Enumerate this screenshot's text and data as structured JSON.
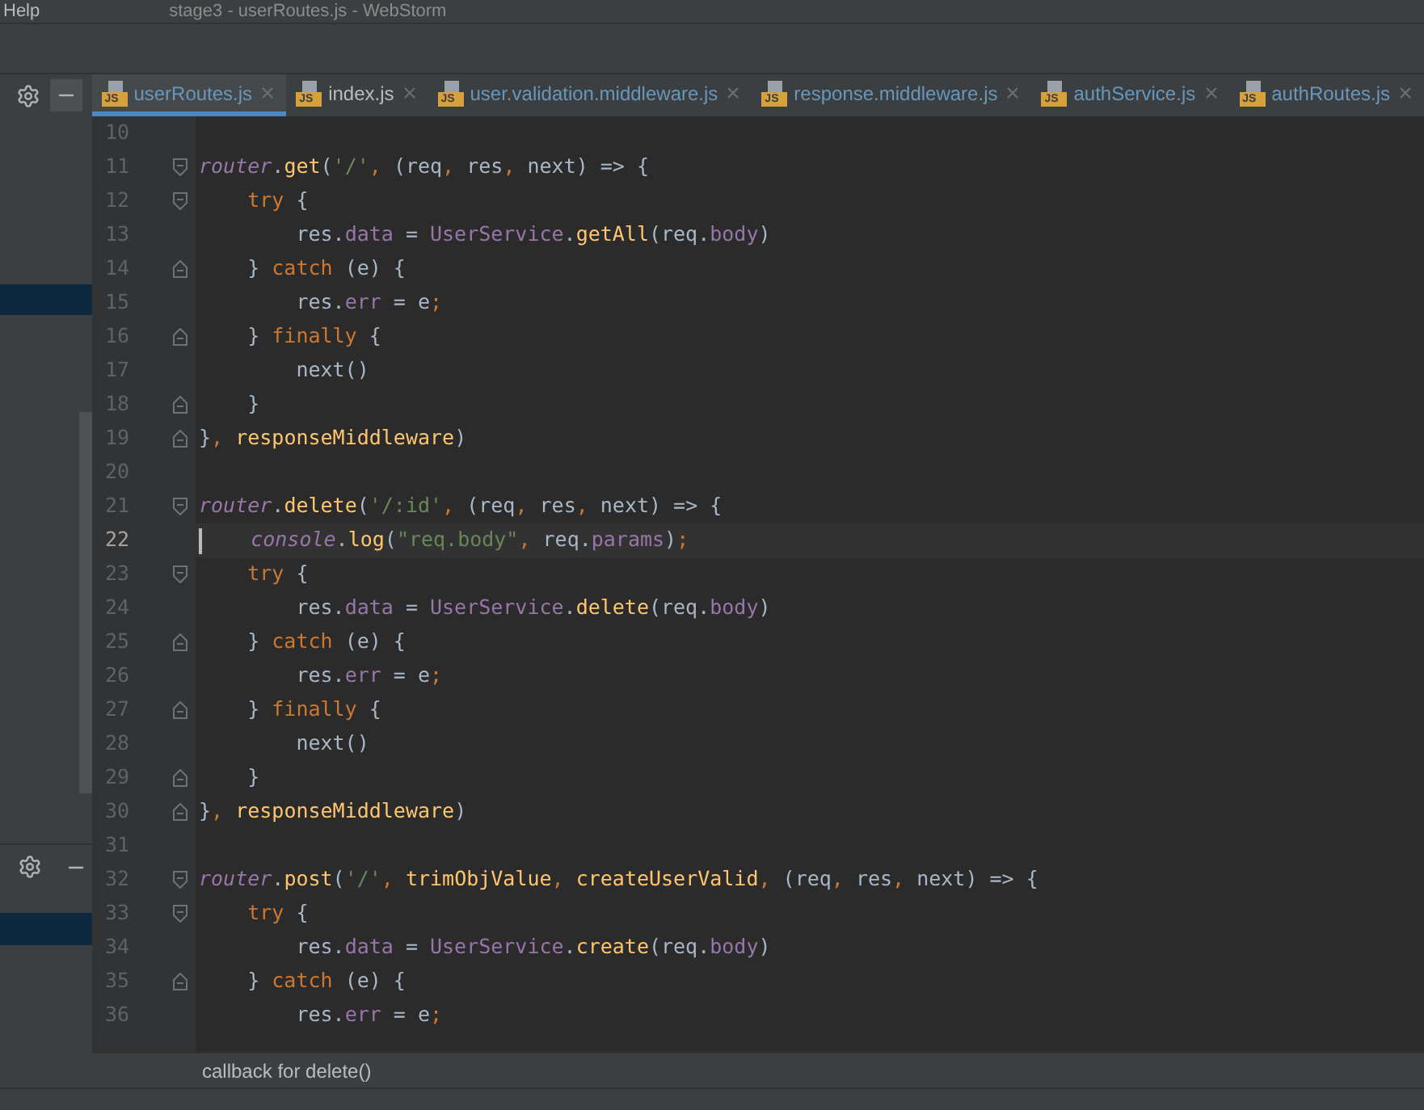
{
  "menu_bar": {
    "menu": "Help",
    "title": "stage3 - userRoutes.js - WebStorm"
  },
  "tabs": [
    {
      "label": "userRoutes.js",
      "badge": "JS",
      "selected": true
    },
    {
      "label": "index.js",
      "badge": "JS",
      "selected": false
    },
    {
      "label": "user.validation.middleware.js",
      "badge": "JS",
      "selected": false
    },
    {
      "label": "response.middleware.js",
      "badge": "JS",
      "selected": false
    },
    {
      "label": "authService.js",
      "badge": "JS",
      "selected": false
    },
    {
      "label": "authRoutes.js",
      "badge": "JS",
      "selected": false
    }
  ],
  "editor": {
    "lines": [
      {
        "number": "10",
        "current": false,
        "fold_start": false,
        "fold_end": false
      },
      {
        "number": "11",
        "current": false,
        "fold_start": true,
        "fold_end": false,
        "tokens": [
          {
            "kind": "obj",
            "text": "router"
          },
          {
            "kind": "plain",
            "text": "."
          },
          {
            "kind": "method",
            "text": "get"
          },
          {
            "kind": "plain",
            "text": "("
          },
          {
            "kind": "str",
            "text": "'/'"
          },
          {
            "kind": "punct",
            "text": ", "
          },
          {
            "kind": "plain",
            "text": "(req"
          },
          {
            "kind": "punct",
            "text": ", "
          },
          {
            "kind": "plain",
            "text": "res"
          },
          {
            "kind": "punct",
            "text": ", "
          },
          {
            "kind": "plain",
            "text": "next) => {"
          }
        ]
      },
      {
        "number": "12",
        "current": false,
        "fold_start": true,
        "fold_end": false,
        "tokens": [
          {
            "kind": "kw",
            "text": "    try"
          },
          {
            "kind": "plain",
            "text": " {"
          }
        ]
      },
      {
        "number": "13",
        "current": false,
        "fold_start": false,
        "fold_end": false,
        "tokens": [
          {
            "kind": "plain",
            "text": "        res."
          },
          {
            "kind": "prop",
            "text": "data"
          },
          {
            "kind": "plain",
            "text": " = "
          },
          {
            "kind": "prop",
            "text": "UserService"
          },
          {
            "kind": "plain",
            "text": "."
          },
          {
            "kind": "method",
            "text": "getAll"
          },
          {
            "kind": "plain",
            "text": "(req."
          },
          {
            "kind": "prop",
            "text": "body"
          },
          {
            "kind": "plain",
            "text": ")"
          }
        ]
      },
      {
        "number": "14",
        "current": false,
        "fold_start": false,
        "fold_end": true,
        "tokens": [
          {
            "kind": "plain",
            "text": "    } "
          },
          {
            "kind": "kw",
            "text": "catch"
          },
          {
            "kind": "plain",
            "text": " (e) {"
          }
        ]
      },
      {
        "number": "15",
        "current": false,
        "fold_start": false,
        "fold_end": false,
        "tokens": [
          {
            "kind": "plain",
            "text": "        res."
          },
          {
            "kind": "prop",
            "text": "err"
          },
          {
            "kind": "plain",
            "text": " = e"
          },
          {
            "kind": "punct",
            "text": ";"
          }
        ]
      },
      {
        "number": "16",
        "current": false,
        "fold_start": false,
        "fold_end": true,
        "tokens": [
          {
            "kind": "plain",
            "text": "    } "
          },
          {
            "kind": "kw",
            "text": "finally"
          },
          {
            "kind": "plain",
            "text": " {"
          }
        ]
      },
      {
        "number": "17",
        "current": false,
        "fold_start": false,
        "fold_end": false,
        "tokens": [
          {
            "kind": "plain",
            "text": "        next()"
          }
        ]
      },
      {
        "number": "18",
        "current": false,
        "fold_start": false,
        "fold_end": true,
        "tokens": [
          {
            "kind": "plain",
            "text": "    }"
          }
        ]
      },
      {
        "number": "19",
        "current": false,
        "fold_start": false,
        "fold_end": true,
        "tokens": [
          {
            "kind": "plain",
            "text": "}"
          },
          {
            "kind": "punct",
            "text": ", "
          },
          {
            "kind": "method",
            "text": "responseMiddleware"
          },
          {
            "kind": "plain",
            "text": ")"
          }
        ]
      },
      {
        "number": "20",
        "current": false,
        "fold_start": false,
        "fold_end": false
      },
      {
        "number": "21",
        "current": false,
        "fold_start": true,
        "fold_end": false,
        "tokens": [
          {
            "kind": "obj",
            "text": "router"
          },
          {
            "kind": "plain",
            "text": "."
          },
          {
            "kind": "method",
            "text": "delete"
          },
          {
            "kind": "plain",
            "text": "("
          },
          {
            "kind": "str",
            "text": "'/:id'"
          },
          {
            "kind": "punct",
            "text": ", "
          },
          {
            "kind": "plain",
            "text": "(req"
          },
          {
            "kind": "punct",
            "text": ", "
          },
          {
            "kind": "plain",
            "text": "res"
          },
          {
            "kind": "punct",
            "text": ", "
          },
          {
            "kind": "plain",
            "text": "next) => {"
          }
        ]
      },
      {
        "number": "22",
        "current": true,
        "fold_start": false,
        "fold_end": false,
        "tokens": [
          {
            "kind": "obj",
            "text": "    console"
          },
          {
            "kind": "plain",
            "text": "."
          },
          {
            "kind": "method",
            "text": "log"
          },
          {
            "kind": "plain",
            "text": "("
          },
          {
            "kind": "str",
            "text": "\"req.body\""
          },
          {
            "kind": "punct",
            "text": ", "
          },
          {
            "kind": "plain",
            "text": "req."
          },
          {
            "kind": "prop",
            "text": "params"
          },
          {
            "kind": "plain",
            "text": ")"
          },
          {
            "kind": "punct",
            "text": ";"
          }
        ]
      },
      {
        "number": "23",
        "current": false,
        "fold_start": true,
        "fold_end": false,
        "tokens": [
          {
            "kind": "kw",
            "text": "    try"
          },
          {
            "kind": "plain",
            "text": " {"
          }
        ]
      },
      {
        "number": "24",
        "current": false,
        "fold_start": false,
        "fold_end": false,
        "tokens": [
          {
            "kind": "plain",
            "text": "        res."
          },
          {
            "kind": "prop",
            "text": "data"
          },
          {
            "kind": "plain",
            "text": " = "
          },
          {
            "kind": "prop",
            "text": "UserService"
          },
          {
            "kind": "plain",
            "text": "."
          },
          {
            "kind": "method",
            "text": "delete"
          },
          {
            "kind": "plain",
            "text": "(req."
          },
          {
            "kind": "prop",
            "text": "body"
          },
          {
            "kind": "plain",
            "text": ")"
          }
        ]
      },
      {
        "number": "25",
        "current": false,
        "fold_start": false,
        "fold_end": true,
        "tokens": [
          {
            "kind": "plain",
            "text": "    } "
          },
          {
            "kind": "kw",
            "text": "catch"
          },
          {
            "kind": "plain",
            "text": " (e) {"
          }
        ]
      },
      {
        "number": "26",
        "current": false,
        "fold_start": false,
        "fold_end": false,
        "tokens": [
          {
            "kind": "plain",
            "text": "        res."
          },
          {
            "kind": "prop",
            "text": "err"
          },
          {
            "kind": "plain",
            "text": " = e"
          },
          {
            "kind": "punct",
            "text": ";"
          }
        ]
      },
      {
        "number": "27",
        "current": false,
        "fold_start": false,
        "fold_end": true,
        "tokens": [
          {
            "kind": "plain",
            "text": "    } "
          },
          {
            "kind": "kw",
            "text": "finally"
          },
          {
            "kind": "plain",
            "text": " {"
          }
        ]
      },
      {
        "number": "28",
        "current": false,
        "fold_start": false,
        "fold_end": false,
        "tokens": [
          {
            "kind": "plain",
            "text": "        next()"
          }
        ]
      },
      {
        "number": "29",
        "current": false,
        "fold_start": false,
        "fold_end": true,
        "tokens": [
          {
            "kind": "plain",
            "text": "    }"
          }
        ]
      },
      {
        "number": "30",
        "current": false,
        "fold_start": false,
        "fold_end": true,
        "tokens": [
          {
            "kind": "plain",
            "text": "}"
          },
          {
            "kind": "punct",
            "text": ", "
          },
          {
            "kind": "method",
            "text": "responseMiddleware"
          },
          {
            "kind": "plain",
            "text": ")"
          }
        ]
      },
      {
        "number": "31",
        "current": false,
        "fold_start": false,
        "fold_end": false
      },
      {
        "number": "32",
        "current": false,
        "fold_start": true,
        "fold_end": false,
        "tokens": [
          {
            "kind": "obj",
            "text": "router"
          },
          {
            "kind": "plain",
            "text": "."
          },
          {
            "kind": "method",
            "text": "post"
          },
          {
            "kind": "plain",
            "text": "("
          },
          {
            "kind": "str",
            "text": "'/'"
          },
          {
            "kind": "punct",
            "text": ", "
          },
          {
            "kind": "method",
            "text": "trimObjValue"
          },
          {
            "kind": "punct",
            "text": ", "
          },
          {
            "kind": "method",
            "text": "createUserValid"
          },
          {
            "kind": "punct",
            "text": ", "
          },
          {
            "kind": "plain",
            "text": "(req"
          },
          {
            "kind": "punct",
            "text": ", "
          },
          {
            "kind": "plain",
            "text": "res"
          },
          {
            "kind": "punct",
            "text": ", "
          },
          {
            "kind": "plain",
            "text": "next) => {"
          }
        ]
      },
      {
        "number": "33",
        "current": false,
        "fold_start": true,
        "fold_end": false,
        "tokens": [
          {
            "kind": "kw",
            "text": "    try"
          },
          {
            "kind": "plain",
            "text": " {"
          }
        ]
      },
      {
        "number": "34",
        "current": false,
        "fold_start": false,
        "fold_end": false,
        "tokens": [
          {
            "kind": "plain",
            "text": "        res."
          },
          {
            "kind": "prop",
            "text": "data"
          },
          {
            "kind": "plain",
            "text": " = "
          },
          {
            "kind": "prop",
            "text": "UserService"
          },
          {
            "kind": "plain",
            "text": "."
          },
          {
            "kind": "method",
            "text": "create"
          },
          {
            "kind": "plain",
            "text": "(req."
          },
          {
            "kind": "prop",
            "text": "body"
          },
          {
            "kind": "plain",
            "text": ")"
          }
        ]
      },
      {
        "number": "35",
        "current": false,
        "fold_start": false,
        "fold_end": true,
        "tokens": [
          {
            "kind": "plain",
            "text": "    } "
          },
          {
            "kind": "kw",
            "text": "catch"
          },
          {
            "kind": "plain",
            "text": " (e) {"
          }
        ]
      },
      {
        "number": "36",
        "current": false,
        "fold_start": false,
        "fold_end": false,
        "tokens": [
          {
            "kind": "plain",
            "text": "        res."
          },
          {
            "kind": "prop",
            "text": "err"
          },
          {
            "kind": "plain",
            "text": " = e"
          },
          {
            "kind": "punct",
            "text": ";"
          }
        ]
      }
    ]
  },
  "tooltip": "callback for delete()"
}
